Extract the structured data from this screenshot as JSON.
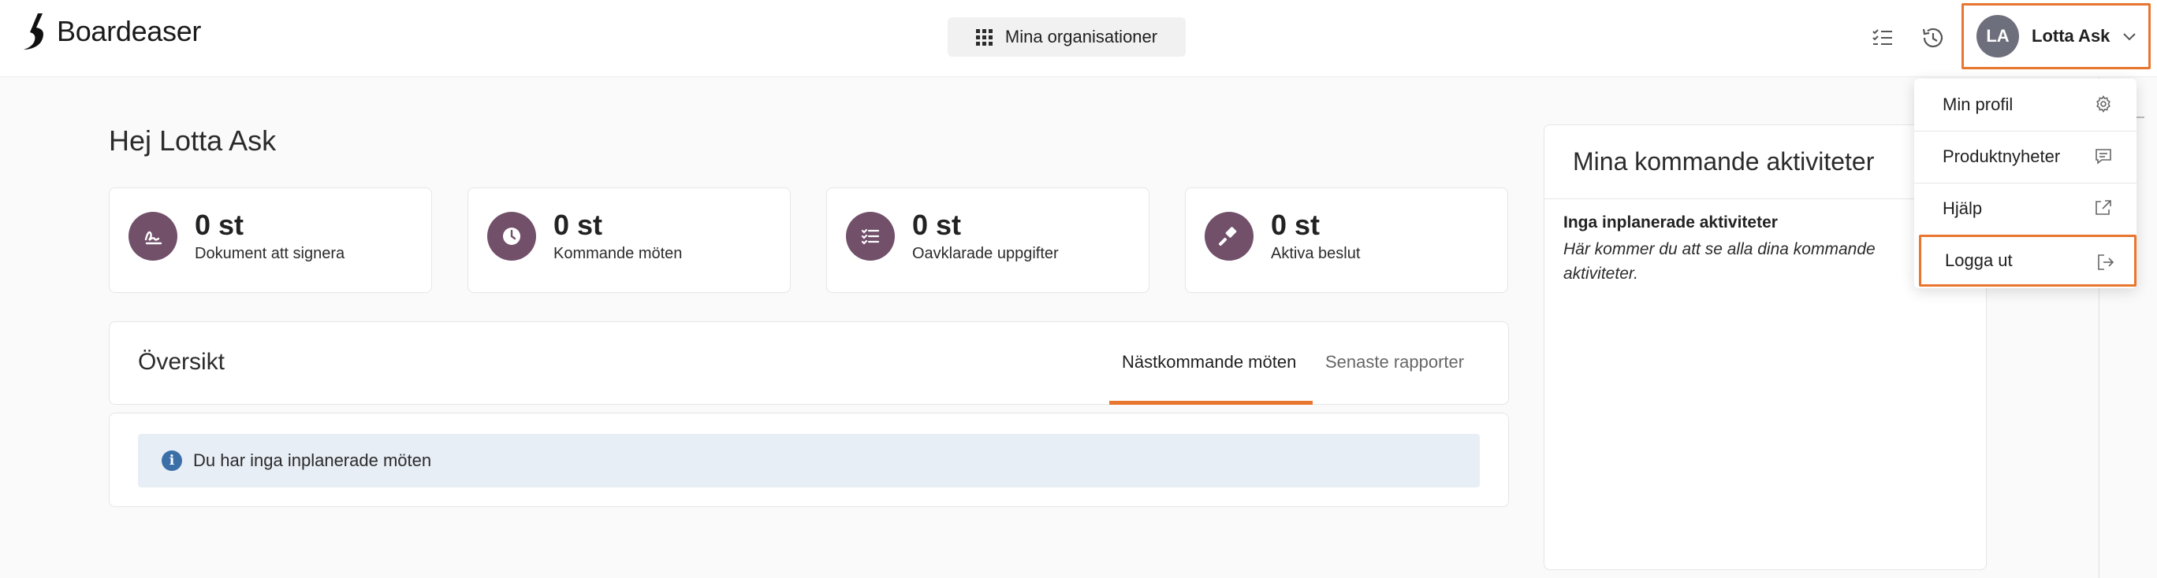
{
  "header": {
    "brand": "Boardeaser",
    "org_button_label": "Mina organisationer",
    "user": {
      "initials": "LA",
      "name": "Lotta Ask"
    },
    "icons": [
      "task-list-icon",
      "history-icon"
    ]
  },
  "main": {
    "greeting": "Hej Lotta Ask",
    "stats": [
      {
        "value": "0 st",
        "label": "Dokument att signera",
        "icon": "signature-icon"
      },
      {
        "value": "0 st",
        "label": "Kommande möten",
        "icon": "clock-icon"
      },
      {
        "value": "0 st",
        "label": "Oavklarade uppgifter",
        "icon": "checklist-icon"
      },
      {
        "value": "0 st",
        "label": "Aktiva beslut",
        "icon": "gavel-icon"
      }
    ],
    "overview": {
      "title": "Översikt",
      "tabs": [
        {
          "label": "Nästkommande möten",
          "active": true
        },
        {
          "label": "Senaste rapporter",
          "active": false
        }
      ],
      "info_message": "Du har inga inplanerade möten"
    },
    "activities": {
      "title": "Mina kommande aktiviteter",
      "empty_title": "Inga inplanerade aktiviteter",
      "empty_text": "Här kommer du att se alla dina kommande aktiviteter."
    }
  },
  "dropdown": {
    "items": [
      {
        "label": "Min profil",
        "icon": "gear-icon"
      },
      {
        "label": "Produktnyheter",
        "icon": "message-icon"
      },
      {
        "label": "Hjälp",
        "icon": "external-link-icon"
      },
      {
        "label": "Logga ut",
        "icon": "logout-icon"
      }
    ]
  },
  "colors": {
    "accent": "#e8762f",
    "stat_icon_bg": "#72506a",
    "avatar_bg": "#6e6f7c",
    "info_bg": "#e8eef6",
    "info_icon": "#3a6fa8"
  }
}
